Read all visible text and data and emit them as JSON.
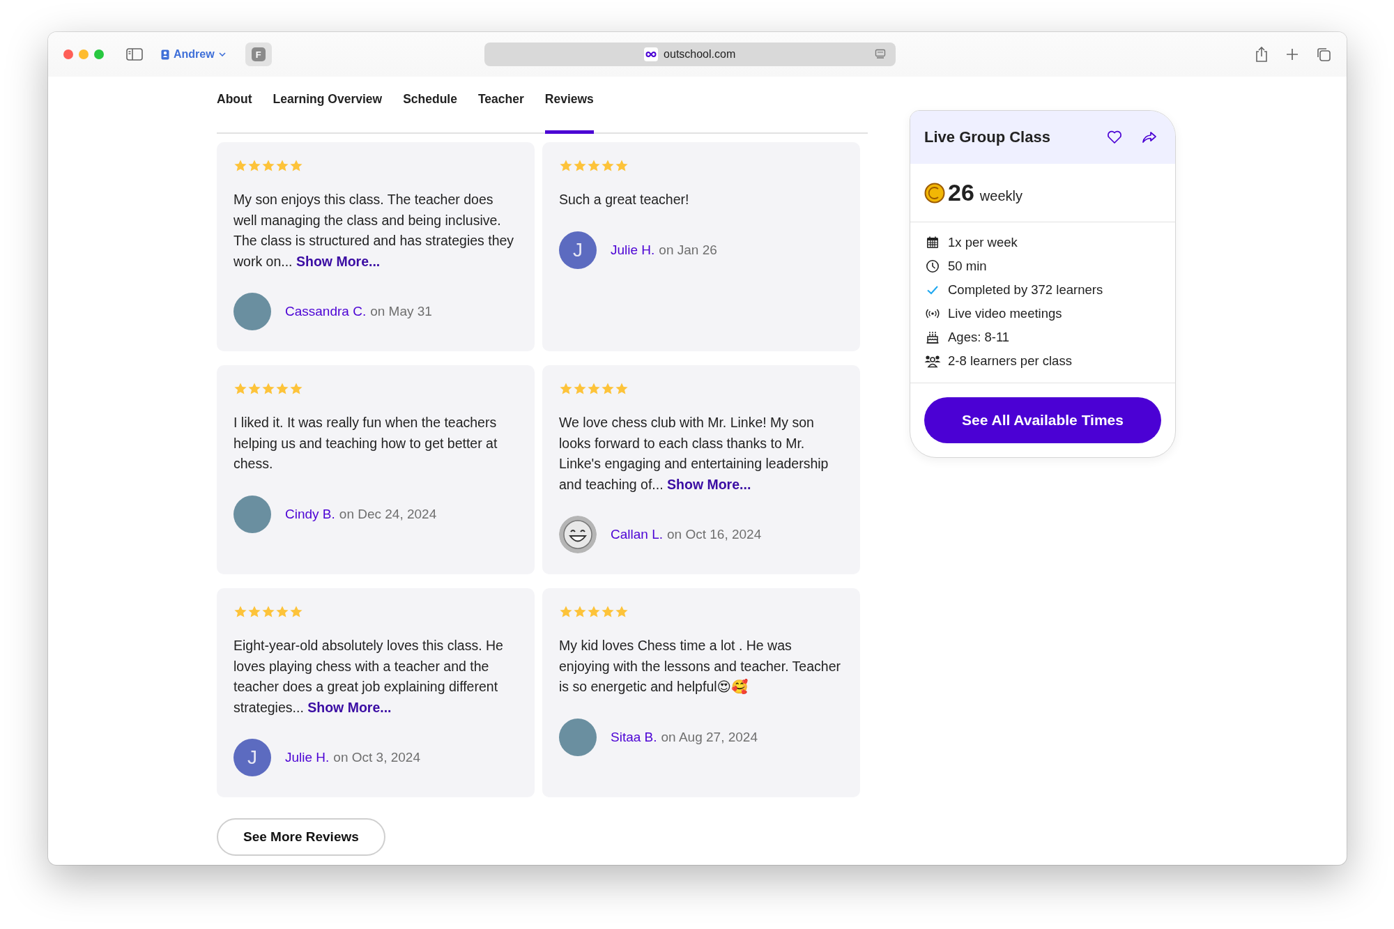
{
  "browser": {
    "profile": "Andrew",
    "tab_icon_letter": "F",
    "url": "outschool.com"
  },
  "tabs": [
    {
      "label": "About",
      "selected": false
    },
    {
      "label": "Learning Overview",
      "selected": false
    },
    {
      "label": "Schedule",
      "selected": false
    },
    {
      "label": "Teacher",
      "selected": false
    },
    {
      "label": "Reviews",
      "selected": true
    }
  ],
  "reviews": [
    {
      "stars": 5,
      "text": "My son enjoys this class. The teacher does well managing the class and being inclusive. The class is structured and has strategies they work on...",
      "show_more": "Show More...",
      "author": "Cassandra C.",
      "date": "on May 31",
      "avatar": {
        "kind": "photo"
      }
    },
    {
      "stars": 5,
      "text": "Such a great teacher!",
      "author": "Julie H.",
      "date": "on Jan 26",
      "avatar": {
        "kind": "letter",
        "letter": "J"
      }
    },
    {
      "stars": 5,
      "text": "I liked it. It was really fun when the teachers helping us and teaching how to get better at chess.",
      "author": "Cindy B.",
      "date": "on Dec 24, 2024",
      "avatar": {
        "kind": "photo"
      }
    },
    {
      "stars": 5,
      "text": "We love chess club with Mr. Linke!  My son looks forward to each class thanks to Mr. Linke's engaging and entertaining leadership and teaching of...",
      "show_more": "Show More...",
      "author": "Callan L.",
      "date": "on Oct 16, 2024",
      "avatar": {
        "kind": "smiley"
      }
    },
    {
      "stars": 5,
      "text": "Eight-year-old absolutely loves this class. He loves playing chess with a teacher and the teacher does a great job explaining different strategies...",
      "show_more": "Show More...",
      "author": "Julie H.",
      "date": "on Oct 3, 2024",
      "avatar": {
        "kind": "letter",
        "letter": "J"
      }
    },
    {
      "stars": 5,
      "text": "My kid loves Chess time a lot . He was enjoying with the lessons and teacher. Teacher is so energetic and helpful😍🥰",
      "author": "Sitaa B.",
      "date": "on Aug 27, 2024",
      "avatar": {
        "kind": "photo"
      }
    }
  ],
  "see_more_button": "See More Reviews",
  "class_card": {
    "title": "Live Group Class",
    "price": "26",
    "period": "weekly",
    "details": [
      {
        "kind": "calendar",
        "text": "1x per week"
      },
      {
        "kind": "clock",
        "text": "50 min"
      },
      {
        "kind": "check",
        "text": "Completed by 372 learners"
      },
      {
        "kind": "live",
        "text": "Live video meetings"
      },
      {
        "kind": "cake",
        "text": "Ages: 8-11"
      },
      {
        "kind": "people",
        "text": "2-8 learners per class"
      }
    ],
    "button": "See All Available Times"
  }
}
